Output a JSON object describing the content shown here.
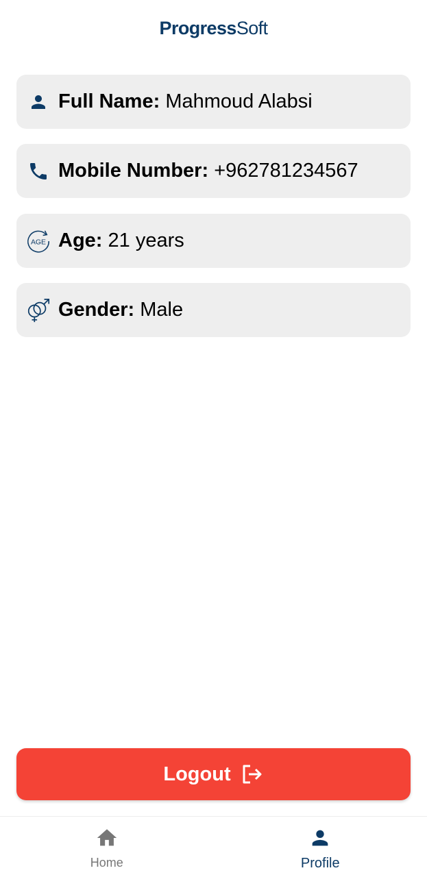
{
  "header": {
    "logo_bold": "Progress",
    "logo_light": "Soft"
  },
  "profile": {
    "full_name": {
      "label": "Full Name:",
      "value": "Mahmoud Alabsi",
      "icon": "person-icon"
    },
    "mobile": {
      "label": "Mobile Number:",
      "value": "+962781234567",
      "icon": "phone-icon"
    },
    "age": {
      "label": "Age:",
      "value": "21 years",
      "icon": "age-icon",
      "icon_text": "AGE"
    },
    "gender": {
      "label": "Gender:",
      "value": "Male",
      "icon": "gender-icon"
    }
  },
  "logout": {
    "label": "Logout",
    "icon": "logout-icon",
    "color": "#f44336"
  },
  "bottom_nav": {
    "items": [
      {
        "label": "Home",
        "icon": "home-icon",
        "active": false
      },
      {
        "label": "Profile",
        "icon": "person-icon",
        "active": true
      }
    ]
  },
  "colors": {
    "brand": "#0d3b66",
    "card_bg": "#eeeeee",
    "inactive": "#777777"
  }
}
